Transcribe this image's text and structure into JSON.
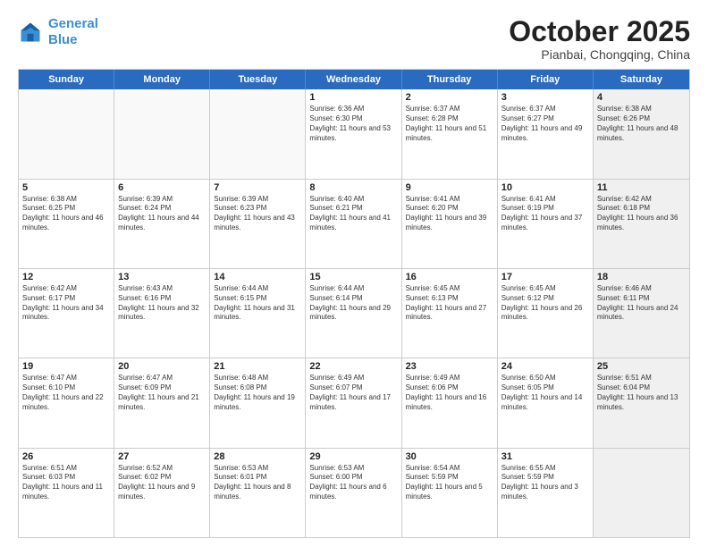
{
  "logo": {
    "line1": "General",
    "line2": "Blue"
  },
  "header": {
    "month": "October 2025",
    "location": "Pianbai, Chongqing, China"
  },
  "weekdays": [
    "Sunday",
    "Monday",
    "Tuesday",
    "Wednesday",
    "Thursday",
    "Friday",
    "Saturday"
  ],
  "rows": [
    [
      {
        "day": "",
        "text": "",
        "empty": true
      },
      {
        "day": "",
        "text": "",
        "empty": true
      },
      {
        "day": "",
        "text": "",
        "empty": true
      },
      {
        "day": "1",
        "text": "Sunrise: 6:36 AM\nSunset: 6:30 PM\nDaylight: 11 hours and 53 minutes."
      },
      {
        "day": "2",
        "text": "Sunrise: 6:37 AM\nSunset: 6:28 PM\nDaylight: 11 hours and 51 minutes."
      },
      {
        "day": "3",
        "text": "Sunrise: 6:37 AM\nSunset: 6:27 PM\nDaylight: 11 hours and 49 minutes."
      },
      {
        "day": "4",
        "text": "Sunrise: 6:38 AM\nSunset: 6:26 PM\nDaylight: 11 hours and 48 minutes.",
        "shaded": true
      }
    ],
    [
      {
        "day": "5",
        "text": "Sunrise: 6:38 AM\nSunset: 6:25 PM\nDaylight: 11 hours and 46 minutes."
      },
      {
        "day": "6",
        "text": "Sunrise: 6:39 AM\nSunset: 6:24 PM\nDaylight: 11 hours and 44 minutes."
      },
      {
        "day": "7",
        "text": "Sunrise: 6:39 AM\nSunset: 6:23 PM\nDaylight: 11 hours and 43 minutes."
      },
      {
        "day": "8",
        "text": "Sunrise: 6:40 AM\nSunset: 6:21 PM\nDaylight: 11 hours and 41 minutes."
      },
      {
        "day": "9",
        "text": "Sunrise: 6:41 AM\nSunset: 6:20 PM\nDaylight: 11 hours and 39 minutes."
      },
      {
        "day": "10",
        "text": "Sunrise: 6:41 AM\nSunset: 6:19 PM\nDaylight: 11 hours and 37 minutes."
      },
      {
        "day": "11",
        "text": "Sunrise: 6:42 AM\nSunset: 6:18 PM\nDaylight: 11 hours and 36 minutes.",
        "shaded": true
      }
    ],
    [
      {
        "day": "12",
        "text": "Sunrise: 6:42 AM\nSunset: 6:17 PM\nDaylight: 11 hours and 34 minutes."
      },
      {
        "day": "13",
        "text": "Sunrise: 6:43 AM\nSunset: 6:16 PM\nDaylight: 11 hours and 32 minutes."
      },
      {
        "day": "14",
        "text": "Sunrise: 6:44 AM\nSunset: 6:15 PM\nDaylight: 11 hours and 31 minutes."
      },
      {
        "day": "15",
        "text": "Sunrise: 6:44 AM\nSunset: 6:14 PM\nDaylight: 11 hours and 29 minutes."
      },
      {
        "day": "16",
        "text": "Sunrise: 6:45 AM\nSunset: 6:13 PM\nDaylight: 11 hours and 27 minutes."
      },
      {
        "day": "17",
        "text": "Sunrise: 6:45 AM\nSunset: 6:12 PM\nDaylight: 11 hours and 26 minutes."
      },
      {
        "day": "18",
        "text": "Sunrise: 6:46 AM\nSunset: 6:11 PM\nDaylight: 11 hours and 24 minutes.",
        "shaded": true
      }
    ],
    [
      {
        "day": "19",
        "text": "Sunrise: 6:47 AM\nSunset: 6:10 PM\nDaylight: 11 hours and 22 minutes."
      },
      {
        "day": "20",
        "text": "Sunrise: 6:47 AM\nSunset: 6:09 PM\nDaylight: 11 hours and 21 minutes."
      },
      {
        "day": "21",
        "text": "Sunrise: 6:48 AM\nSunset: 6:08 PM\nDaylight: 11 hours and 19 minutes."
      },
      {
        "day": "22",
        "text": "Sunrise: 6:49 AM\nSunset: 6:07 PM\nDaylight: 11 hours and 17 minutes."
      },
      {
        "day": "23",
        "text": "Sunrise: 6:49 AM\nSunset: 6:06 PM\nDaylight: 11 hours and 16 minutes."
      },
      {
        "day": "24",
        "text": "Sunrise: 6:50 AM\nSunset: 6:05 PM\nDaylight: 11 hours and 14 minutes."
      },
      {
        "day": "25",
        "text": "Sunrise: 6:51 AM\nSunset: 6:04 PM\nDaylight: 11 hours and 13 minutes.",
        "shaded": true
      }
    ],
    [
      {
        "day": "26",
        "text": "Sunrise: 6:51 AM\nSunset: 6:03 PM\nDaylight: 11 hours and 11 minutes."
      },
      {
        "day": "27",
        "text": "Sunrise: 6:52 AM\nSunset: 6:02 PM\nDaylight: 11 hours and 9 minutes."
      },
      {
        "day": "28",
        "text": "Sunrise: 6:53 AM\nSunset: 6:01 PM\nDaylight: 11 hours and 8 minutes."
      },
      {
        "day": "29",
        "text": "Sunrise: 6:53 AM\nSunset: 6:00 PM\nDaylight: 11 hours and 6 minutes."
      },
      {
        "day": "30",
        "text": "Sunrise: 6:54 AM\nSunset: 5:59 PM\nDaylight: 11 hours and 5 minutes."
      },
      {
        "day": "31",
        "text": "Sunrise: 6:55 AM\nSunset: 5:59 PM\nDaylight: 11 hours and 3 minutes."
      },
      {
        "day": "",
        "text": "",
        "empty": true,
        "shaded": true
      }
    ]
  ]
}
